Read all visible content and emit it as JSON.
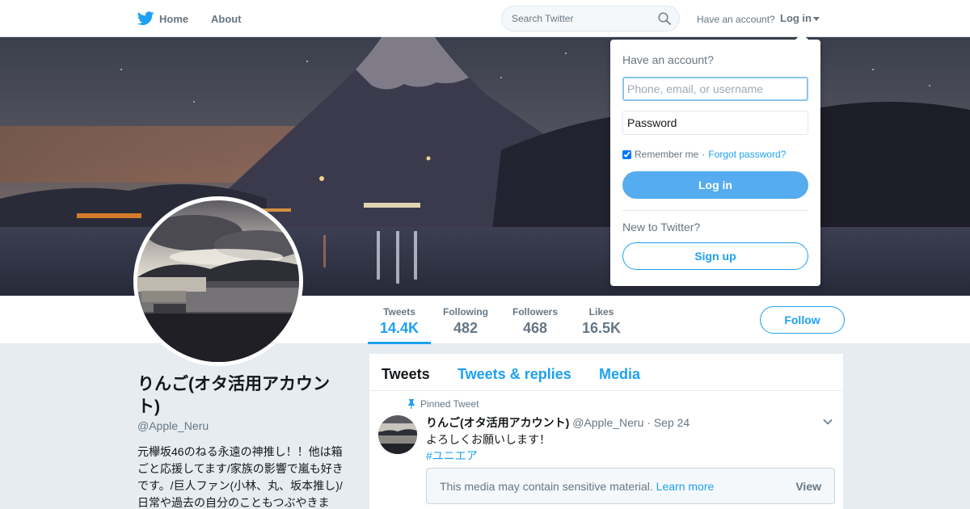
{
  "topbar": {
    "home_label": "Home",
    "about_label": "About",
    "search_placeholder": "Search Twitter",
    "have_account": "Have an account?",
    "login_label": "Log in"
  },
  "profile": {
    "name": "りんご(オタ活用アカウント)",
    "handle": "@Apple_Neru",
    "bio": "元欅坂46のねる永遠の神推し！！他は箱ごと応援してます/家族の影響で嵐も好きです。/巨人ファン(小林、丸、坂本推し)/日常や過去の自分のこともつぶやきま"
  },
  "stats": [
    {
      "label": "Tweets",
      "value": "14.4K",
      "active": true
    },
    {
      "label": "Following",
      "value": "482",
      "active": false
    },
    {
      "label": "Followers",
      "value": "468",
      "active": false
    },
    {
      "label": "Likes",
      "value": "16.5K",
      "active": false
    }
  ],
  "follow_label": "Follow",
  "timeline": {
    "tabs": [
      "Tweets",
      "Tweets & replies",
      "Media"
    ],
    "pinned_label": "Pinned Tweet",
    "tweet": {
      "fullname": "りんご(オタ活用アカウント)",
      "username": "@Apple_Neru",
      "separator": "·",
      "date": "Sep 24",
      "text": "よろしくお願いします！",
      "hashtag": "#ユニエア",
      "sensitive_text": "This media may contain sensitive material.",
      "learn_more": "Learn more",
      "view_label": "View"
    }
  },
  "login_dropdown": {
    "title": "Have an account?",
    "username_placeholder": "Phone, email, or username",
    "password_placeholder": "Password",
    "remember_label": "Remember me",
    "separator": "·",
    "forgot_label": "Forgot password?",
    "login_button": "Log in",
    "new_label": "New to Twitter?",
    "signup_button": "Sign up"
  },
  "colors": {
    "accent": "#1da1f2",
    "login_button_bg": "#55acee",
    "page_bg": "#e6ecf0",
    "muted_text": "#657786"
  },
  "icons": [
    "twitter-bird-icon",
    "search-icon",
    "caret-down-icon",
    "pin-icon",
    "chevron-down-icon"
  ]
}
